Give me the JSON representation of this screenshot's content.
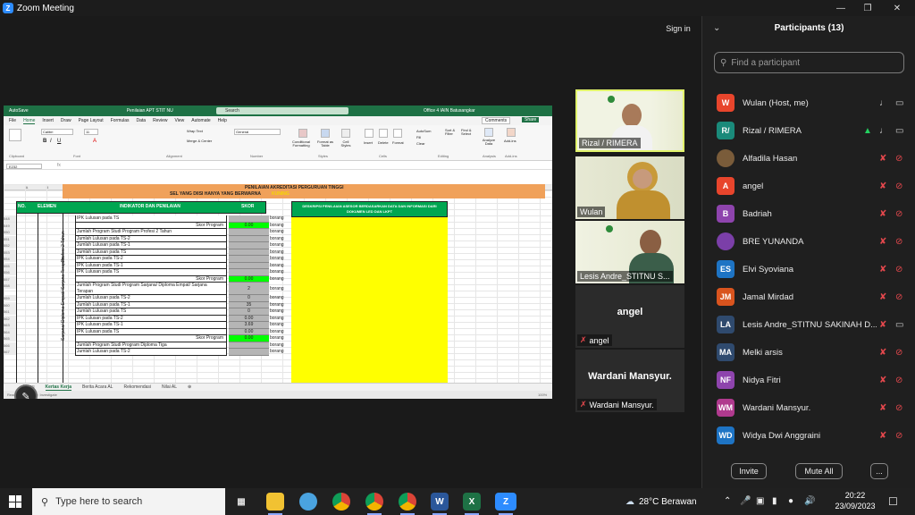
{
  "window": {
    "title": "Zoom Meeting",
    "sign_in": "Sign in"
  },
  "excel": {
    "autosave": "AutoSave",
    "filename": "Penilaian APT STIT NU",
    "search_placeholder": "Search",
    "account": "Office 4 IAIN Batusangkar",
    "menu": [
      "File",
      "Home",
      "Insert",
      "Draw",
      "Page Layout",
      "Formulas",
      "Data",
      "Review",
      "View",
      "Automate",
      "Help"
    ],
    "active_menu": "Home",
    "comments": "Comments",
    "share": "Share",
    "font_name": "Calibri",
    "font_size": "11",
    "wrap_text": "Wrap Text",
    "merge_center": "Merge & Center",
    "number_format": "General",
    "ribbon_groups": [
      "Clipboard",
      "Font",
      "Alignment",
      "Number",
      "Styles",
      "Cells",
      "Editing",
      "Analysis",
      "Add-ins"
    ],
    "cond_format": "Conditional Formatting",
    "format_table": "Format as Table",
    "cell_styles": "Cell Styles",
    "insert": "Insert",
    "delete": "Delete",
    "format": "Format",
    "autosum": "AutoSum",
    "fill": "Fill",
    "clear": "Clear",
    "sort_filter": "Sort & Filter",
    "find_select": "Find & Select",
    "analyze_data": "Analyze Data",
    "addins": "Add-ins",
    "name_box": "E232",
    "columns": [
      "A",
      "B",
      "C",
      "D",
      "E",
      "F",
      "N",
      "O",
      "P",
      "Q",
      "R"
    ],
    "banner_line1": "PENILAIAN AKREDITASI PERGURUAN TINGGI",
    "banner_line2": "SEL YANG DIISI HANYA YANG BERWARNA",
    "banner_kuning": "KUNING",
    "hdr_no": "NO.",
    "hdr_elemen": "ELEMEN",
    "hdr_indikator": "INDIKATOR DAN PENILAIAN",
    "hdr_skor": "SKOR",
    "hdr_deskripsi": "DESKRIPSI PENILAIAN ASESOR BERDASARKAN DATA DAN INFORMASI DARI DOKUMEN LED DAN LKPT",
    "side_label_1": "Profesi 2 Tahun",
    "side_label_2": "Sarjana/ Diploma Empat/ Sarjana Terapan",
    "rows": [
      {
        "num": "548",
        "text": "IPK Lulusan pada TS",
        "skor": "",
        "f": "borang",
        "type": "normal"
      },
      {
        "num": "549",
        "text": "Skor Program",
        "skor": "0.00",
        "f": "borang",
        "type": "skor"
      },
      {
        "num": "550",
        "text": "Jumlah Program Studi Program Profesi 2 Tahun",
        "skor": "",
        "f": "borang",
        "type": "normal"
      },
      {
        "num": "551",
        "text": "Jumlah Lulusan pada TS-2",
        "skor": "",
        "f": "borang",
        "type": "normal"
      },
      {
        "num": "552",
        "text": "Jumlah Lulusan pada TS-1",
        "skor": "",
        "f": "borang",
        "type": "normal"
      },
      {
        "num": "553",
        "text": "Jumlah Lulusan pada TS",
        "skor": "",
        "f": "borang",
        "type": "normal"
      },
      {
        "num": "554",
        "text": "IPK Lulusan pada TS-2",
        "skor": "",
        "f": "borang",
        "type": "normal"
      },
      {
        "num": "555",
        "text": "IPK Lulusan pada TS-1",
        "skor": "",
        "f": "borang",
        "type": "normal"
      },
      {
        "num": "556",
        "text": "IPK Lulusan pada TS",
        "skor": "",
        "f": "borang",
        "type": "normal"
      },
      {
        "num": "557",
        "text": "Skor Program",
        "skor": "0.00",
        "f": "borang",
        "type": "skor"
      },
      {
        "num": "558",
        "text": "Jumlah Program Studi Program Sarjana/ Diploma Empat/ Sarjana Terapan",
        "skor": "2",
        "f": "borang",
        "type": "tall"
      },
      {
        "num": "559",
        "text": "Jumlah Lulusan pada TS-2",
        "skor": "0",
        "f": "borang",
        "type": "normal"
      },
      {
        "num": "560",
        "text": "Jumlah Lulusan pada TS-1",
        "skor": "35",
        "f": "borang",
        "type": "normal"
      },
      {
        "num": "561",
        "text": "Jumlah Lulusan pada TS",
        "skor": "0",
        "f": "borang",
        "type": "normal"
      },
      {
        "num": "562",
        "text": "IPK Lulusan pada TS-2",
        "skor": "0.00",
        "f": "borang",
        "type": "normal"
      },
      {
        "num": "563",
        "text": "IPK Lulusan pada TS-1",
        "skor": "3.69",
        "f": "borang",
        "type": "normal"
      },
      {
        "num": "564",
        "text": "IPK Lulusan pada TS",
        "skor": "0.00",
        "f": "borang",
        "type": "normal"
      },
      {
        "num": "565",
        "text": "Skor Program",
        "skor": "0.00",
        "f": "borang",
        "type": "skor"
      },
      {
        "num": "566",
        "text": "Jumlah Program Studi Program Diploma Tiga",
        "skor": "",
        "f": "borang",
        "type": "normal"
      },
      {
        "num": "567",
        "text": "Jumlah Lulusan pada TS-2",
        "skor": "",
        "f": "borang",
        "type": "normal"
      }
    ],
    "sheet_tabs": [
      "Menu",
      "Kertas Kerja",
      "Berita Acara AL",
      "Rekomendasi",
      "Nilai AL"
    ],
    "active_sheet": "Kertas Kerja",
    "status_text": "Ready   Accessibility: Investigate",
    "zoom": "100%"
  },
  "video_tiles": [
    {
      "name": "Rizal / RIMERA",
      "active": true
    },
    {
      "name": "Wulan",
      "active": false
    },
    {
      "name": "Lesis Andre_STITNU S...",
      "active": false
    }
  ],
  "name_tiles": [
    {
      "big": "angel",
      "label": "angel"
    },
    {
      "big": "Wardani Mansyur.",
      "label": "Wardani Mansyur."
    }
  ],
  "participants": {
    "title": "Participants (13)",
    "search_placeholder": "Find a participant",
    "list": [
      {
        "initials": "W",
        "name": "Wulan (Host, me)",
        "color": "#e8452c",
        "mic": "on",
        "video": "on",
        "share": false
      },
      {
        "initials": "R/",
        "name": "Rizal / RIMERA",
        "color": "#1a8a7a",
        "mic": "on",
        "video": "on",
        "share": true
      },
      {
        "initials": "",
        "name": "Alfadila Hasan",
        "color": "#7a5c3a",
        "mic": "muted",
        "video": "off",
        "share": false
      },
      {
        "initials": "A",
        "name": "angel",
        "color": "#e8452c",
        "mic": "muted",
        "video": "off",
        "share": false
      },
      {
        "initials": "B",
        "name": "Badriah",
        "color": "#8e44ad",
        "mic": "muted",
        "video": "off",
        "share": false
      },
      {
        "initials": "",
        "name": "BRE YUNANDA",
        "color": "#7b3fa8",
        "mic": "muted",
        "video": "off",
        "share": false
      },
      {
        "initials": "ES",
        "name": "Elvi Syoviana",
        "color": "#1e74c4",
        "mic": "muted",
        "video": "off",
        "share": false
      },
      {
        "initials": "JM",
        "name": "Jamal Mirdad",
        "color": "#d9541e",
        "mic": "muted",
        "video": "off",
        "share": false
      },
      {
        "initials": "LA",
        "name": "Lesis Andre_STITNU SAKINAH D...",
        "color": "#2f4a6e",
        "mic": "muted",
        "video": "on",
        "share": false
      },
      {
        "initials": "MA",
        "name": "Melki arsis",
        "color": "#2f4a6e",
        "mic": "muted",
        "video": "off",
        "share": false
      },
      {
        "initials": "NF",
        "name": "Nidya Fitri",
        "color": "#8e44ad",
        "mic": "muted",
        "video": "off",
        "share": false
      },
      {
        "initials": "WM",
        "name": "Wardani Mansyur.",
        "color": "#b03a8e",
        "mic": "muted",
        "video": "off",
        "share": false
      },
      {
        "initials": "WD",
        "name": "Widya Dwi Anggraini",
        "color": "#1e74c4",
        "mic": "muted",
        "video": "off",
        "share": false
      }
    ],
    "invite": "Invite",
    "mute_all": "Mute All",
    "more": "..."
  },
  "taskbar": {
    "search_placeholder": "Type here to search",
    "weather": "28°C  Berawan",
    "time": "20:22",
    "date": "23/09/2023"
  }
}
